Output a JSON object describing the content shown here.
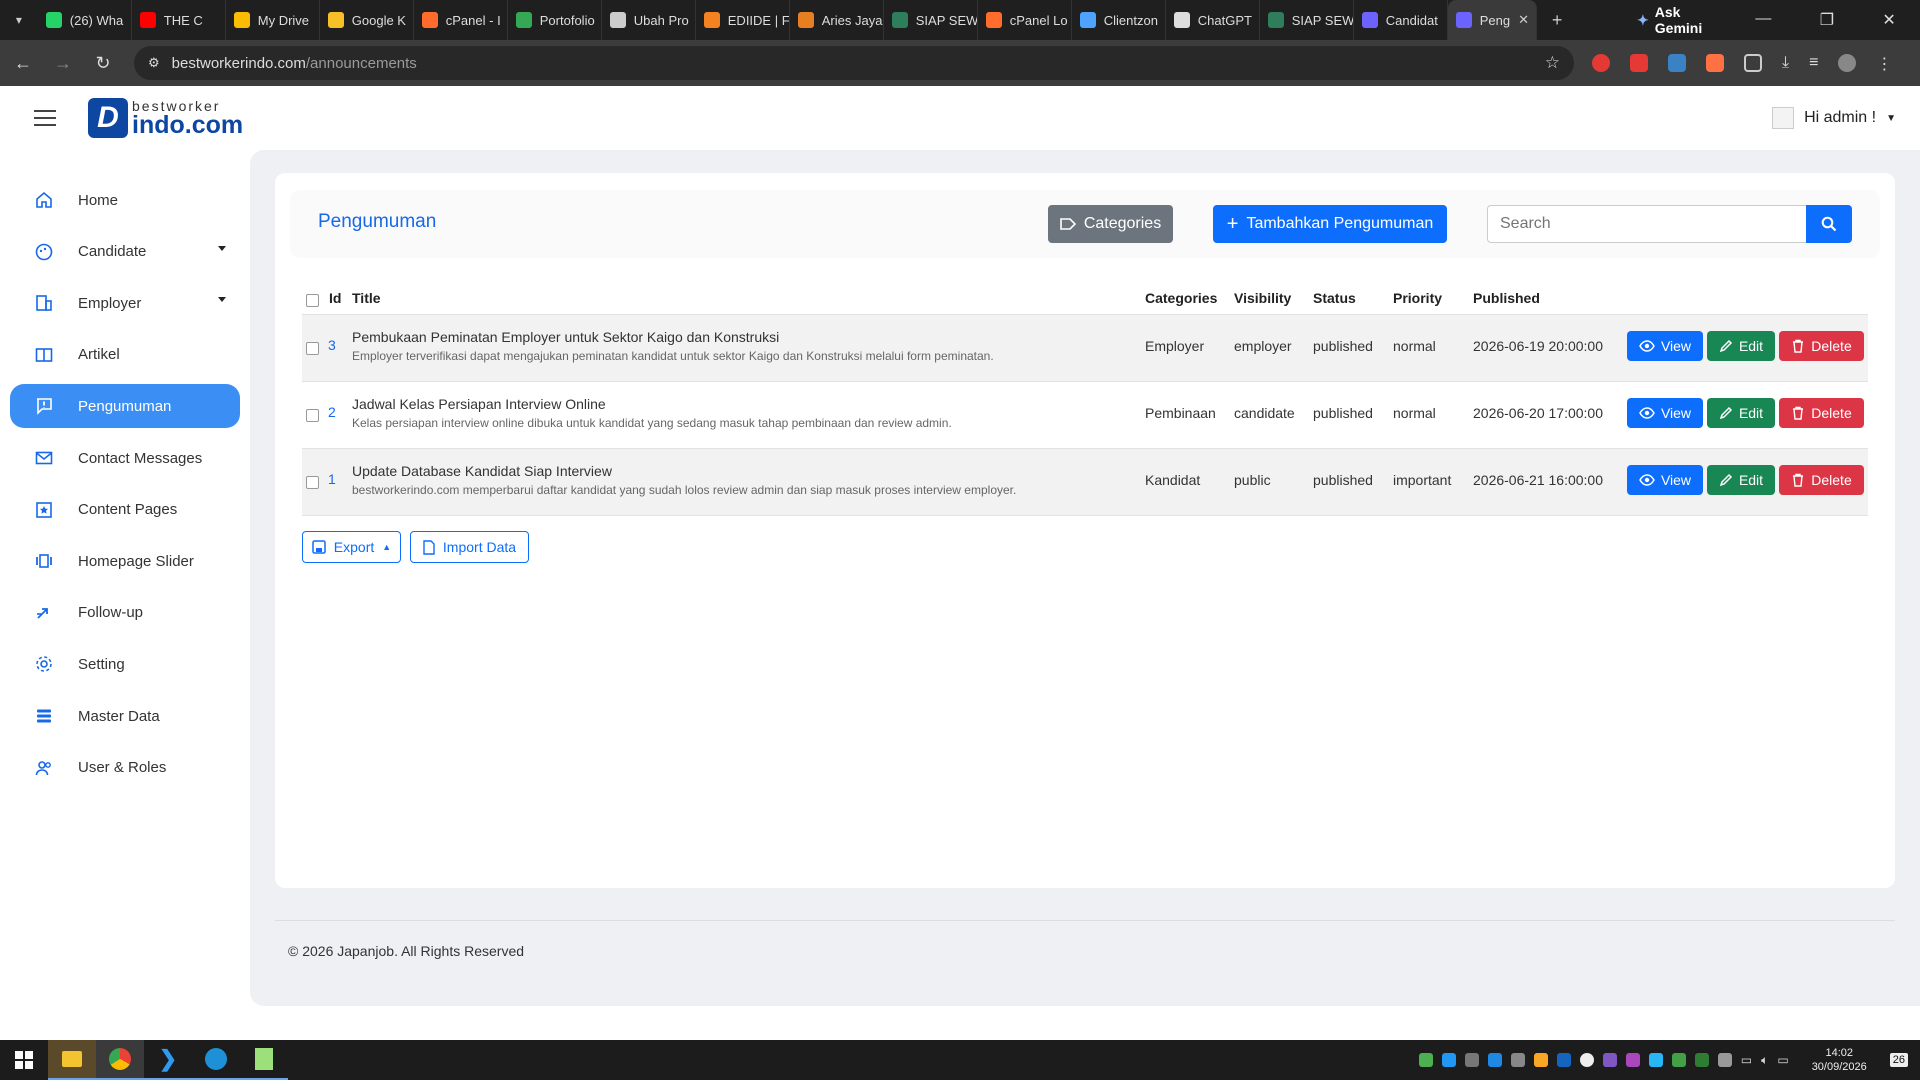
{
  "browser": {
    "tabs": [
      {
        "label": "(26) Wha",
        "color": "#25d366"
      },
      {
        "label": "THE C",
        "color": "#ff0000"
      },
      {
        "label": "My Drive",
        "color": "#fbbc04"
      },
      {
        "label": "Google K",
        "color": "#f6c026"
      },
      {
        "label": "cPanel - I",
        "color": "#ff6c2c"
      },
      {
        "label": "Portofolio",
        "color": "#34a853"
      },
      {
        "label": "Ubah Pro",
        "color": "#cccccc"
      },
      {
        "label": "EDIIDE | F",
        "color": "#f58220"
      },
      {
        "label": "Aries Jaya",
        "color": "#e67e22"
      },
      {
        "label": "SIAP SEW",
        "color": "#2e7d5b"
      },
      {
        "label": "cPanel Lo",
        "color": "#ff6c2c"
      },
      {
        "label": "Clientzon",
        "color": "#4da3ff"
      },
      {
        "label": "ChatGPT",
        "color": "#dddddd"
      },
      {
        "label": "SIAP SEW",
        "color": "#2e7d5b"
      },
      {
        "label": "Candidat",
        "color": "#6c63ff"
      }
    ],
    "active_tab": {
      "label": "Peng",
      "color": "#6c63ff"
    },
    "gemini_label": "Ask Gemini",
    "url_domain": "bestworkerindo.com",
    "url_path": "/announcements"
  },
  "app": {
    "logo_top": "bestworker",
    "logo_bottom": "indo.com",
    "greeting": "Hi admin !"
  },
  "sidebar": {
    "items": [
      {
        "label": "Home",
        "icon": "home-icon"
      },
      {
        "label": "Candidate",
        "icon": "candidate-icon",
        "dropdown": true
      },
      {
        "label": "Employer",
        "icon": "building-icon",
        "dropdown": true
      },
      {
        "label": "Artikel",
        "icon": "book-icon"
      },
      {
        "label": "Pengumuman",
        "icon": "announcement-icon",
        "active": true
      },
      {
        "label": "Contact Messages",
        "icon": "mail-icon"
      },
      {
        "label": "Content Pages",
        "icon": "star-page-icon"
      },
      {
        "label": "Homepage Slider",
        "icon": "slider-icon"
      },
      {
        "label": "Follow-up",
        "icon": "follow-up-icon"
      },
      {
        "label": "Setting",
        "icon": "gear-icon"
      },
      {
        "label": "Master Data",
        "icon": "database-icon"
      },
      {
        "label": "User & Roles",
        "icon": "users-icon"
      }
    ]
  },
  "page": {
    "title": "Pengumuman",
    "categories_btn": "Categories",
    "add_btn": "Tambahkan Pengumuman",
    "search_placeholder": "Search"
  },
  "table": {
    "headers": {
      "id": "Id",
      "title": "Title",
      "categories": "Categories",
      "visibility": "Visibility",
      "status": "Status",
      "priority": "Priority",
      "published": "Published"
    },
    "rows": [
      {
        "id": "3",
        "title": "Pembukaan Peminatan Employer untuk Sektor Kaigo dan Konstruksi",
        "desc": "Employer terverifikasi dapat mengajukan peminatan kandidat untuk sektor Kaigo dan Konstruksi melalui form peminatan.",
        "category": "Employer",
        "visibility": "employer",
        "status": "published",
        "priority": "normal",
        "published": "2026-06-19 20:00:00"
      },
      {
        "id": "2",
        "title": "Jadwal Kelas Persiapan Interview Online",
        "desc": "Kelas persiapan interview online dibuka untuk kandidat yang sedang masuk tahap pembinaan dan review admin.",
        "category": "Pembinaan",
        "visibility": "candidate",
        "status": "published",
        "priority": "normal",
        "published": "2026-06-20 17:00:00"
      },
      {
        "id": "1",
        "title": "Update Database Kandidat Siap Interview",
        "desc": "bestworkerindo.com memperbarui daftar kandidat yang sudah lolos review admin dan siap masuk proses interview employer.",
        "category": "Kandidat",
        "visibility": "public",
        "status": "published",
        "priority": "important",
        "published": "2026-06-21 16:00:00"
      }
    ],
    "actions": {
      "view": "View",
      "edit": "Edit",
      "delete": "Delete"
    }
  },
  "export_btn": "Export",
  "import_btn": "Import Data",
  "footer": "© 2026 Japanjob. All Rights Reserved",
  "taskbar": {
    "time": "14:02",
    "date": "30/09/2026",
    "notif_count": "26"
  },
  "colors": {
    "primary": "#0d6efd",
    "success": "#198754",
    "danger": "#dc3545",
    "secondary": "#6c757d",
    "sidebar_active": "#3b8ef3"
  }
}
